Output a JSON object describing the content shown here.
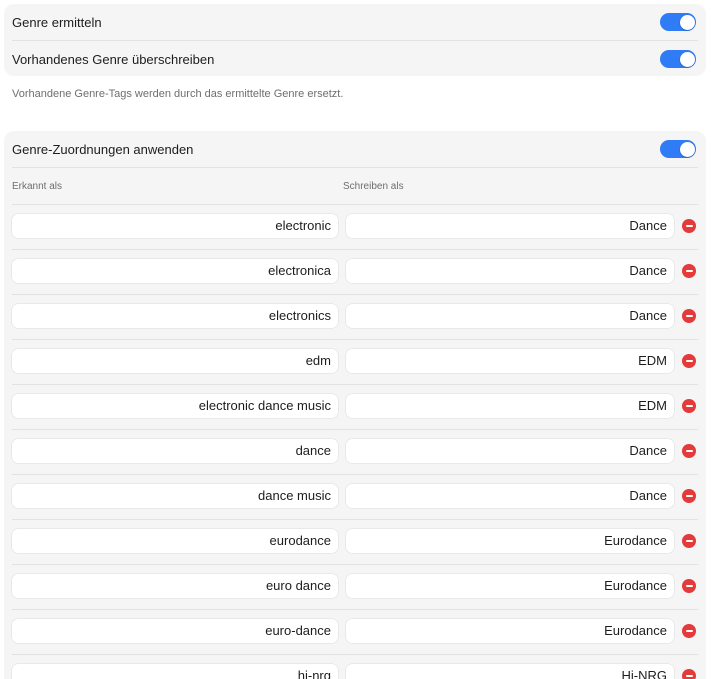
{
  "settings": {
    "detect_genre": {
      "label": "Genre ermitteln",
      "enabled": true
    },
    "overwrite_genre": {
      "label": "Vorhandenes Genre überschreiben",
      "enabled": true
    },
    "overwrite_hint": "Vorhandene Genre-Tags werden durch das ermittelte Genre ersetzt."
  },
  "mappings": {
    "apply": {
      "label": "Genre-Zuordnungen anwenden",
      "enabled": true
    },
    "column_detected": "Erkannt als",
    "column_write": "Schreiben als",
    "rows": [
      {
        "detected": "electronic",
        "write": "Dance"
      },
      {
        "detected": "electronica",
        "write": "Dance"
      },
      {
        "detected": "electronics",
        "write": "Dance"
      },
      {
        "detected": "edm",
        "write": "EDM"
      },
      {
        "detected": "electronic dance music",
        "write": "EDM"
      },
      {
        "detected": "dance",
        "write": "Dance"
      },
      {
        "detected": "dance music",
        "write": "Dance"
      },
      {
        "detected": "eurodance",
        "write": "Eurodance"
      },
      {
        "detected": "euro dance",
        "write": "Eurodance"
      },
      {
        "detected": "euro-dance",
        "write": "Eurodance"
      },
      {
        "detected": "hi-nrg",
        "write": "Hi-NRG"
      }
    ]
  },
  "colors": {
    "accent": "#2f7cf6",
    "remove": "#e5393a"
  },
  "icons": {
    "remove": "minus-circle-icon"
  }
}
